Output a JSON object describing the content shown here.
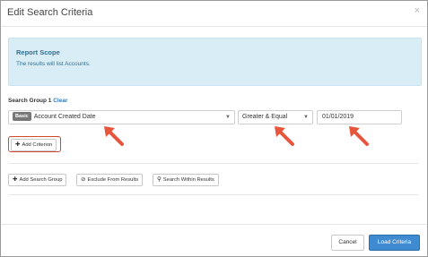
{
  "dialog": {
    "title": "Edit Search Criteria",
    "close_glyph": "×"
  },
  "report_scope": {
    "title": "Report Scope",
    "text": "The results will list Accounts."
  },
  "search_group": {
    "label": "Search Group 1",
    "clear_label": "Clear",
    "criterion": {
      "field_badge": "Basic",
      "field": "Account Created Date",
      "operator": "Greater & Equal",
      "value": "01/01/2019"
    },
    "add_criterion_label": "Add Criterion"
  },
  "group_actions": {
    "add_search_group": "Add Search Group",
    "exclude_from_results": "Exclude From Results",
    "search_within_results": "Search Within Results"
  },
  "footer": {
    "cancel": "Cancel",
    "load_criteria": "Load Criteria"
  },
  "colors": {
    "annotation_arrow": "#e8553d",
    "primary": "#3e8bd2",
    "info_bg": "#d9edf7"
  },
  "icons": {
    "plus": "plus-icon",
    "exclude": "ban-icon",
    "within": "zoom-icon",
    "caret": "caret-down-icon"
  }
}
